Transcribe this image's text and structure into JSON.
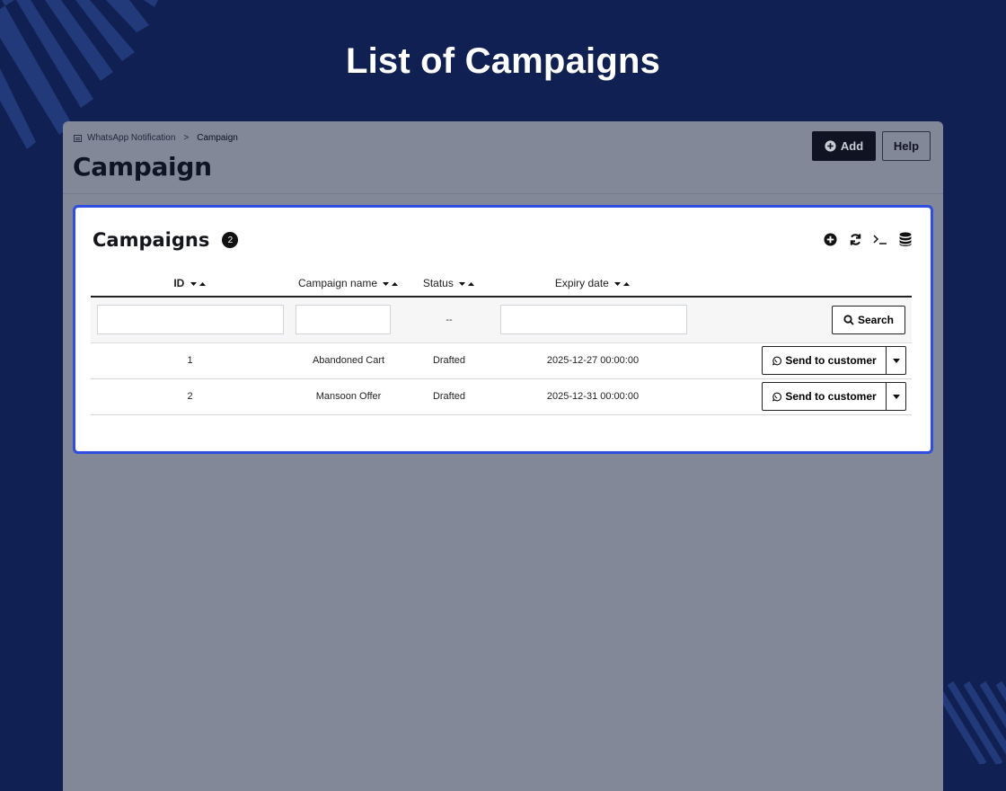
{
  "hero": {
    "title": "List of Campaigns"
  },
  "breadcrumb": {
    "parent": "WhatsApp Notification",
    "separator": ">",
    "current": "Campaign"
  },
  "page": {
    "title": "Campaign"
  },
  "actions": {
    "add_label": "Add",
    "help_label": "Help"
  },
  "card": {
    "title": "Campaigns",
    "count": "2"
  },
  "table": {
    "headers": {
      "id": "ID",
      "campaign_name": "Campaign name",
      "status": "Status",
      "expiry_date": "Expiry date"
    },
    "filters": {
      "status_value": "--",
      "search_label": "Search"
    },
    "rows": [
      {
        "id": "1",
        "name": "Abandoned Cart",
        "status": "Drafted",
        "expiry": "2025-12-27 00:00:00",
        "action_label": "Send to customer"
      },
      {
        "id": "2",
        "name": "Mansoon Offer",
        "status": "Drafted",
        "expiry": "2025-12-31 00:00:00",
        "action_label": "Send to customer"
      }
    ]
  },
  "colors": {
    "background": "#102052",
    "panel": "#828898",
    "card_border": "#2d4ee0",
    "primary_button": "#0f1322"
  }
}
